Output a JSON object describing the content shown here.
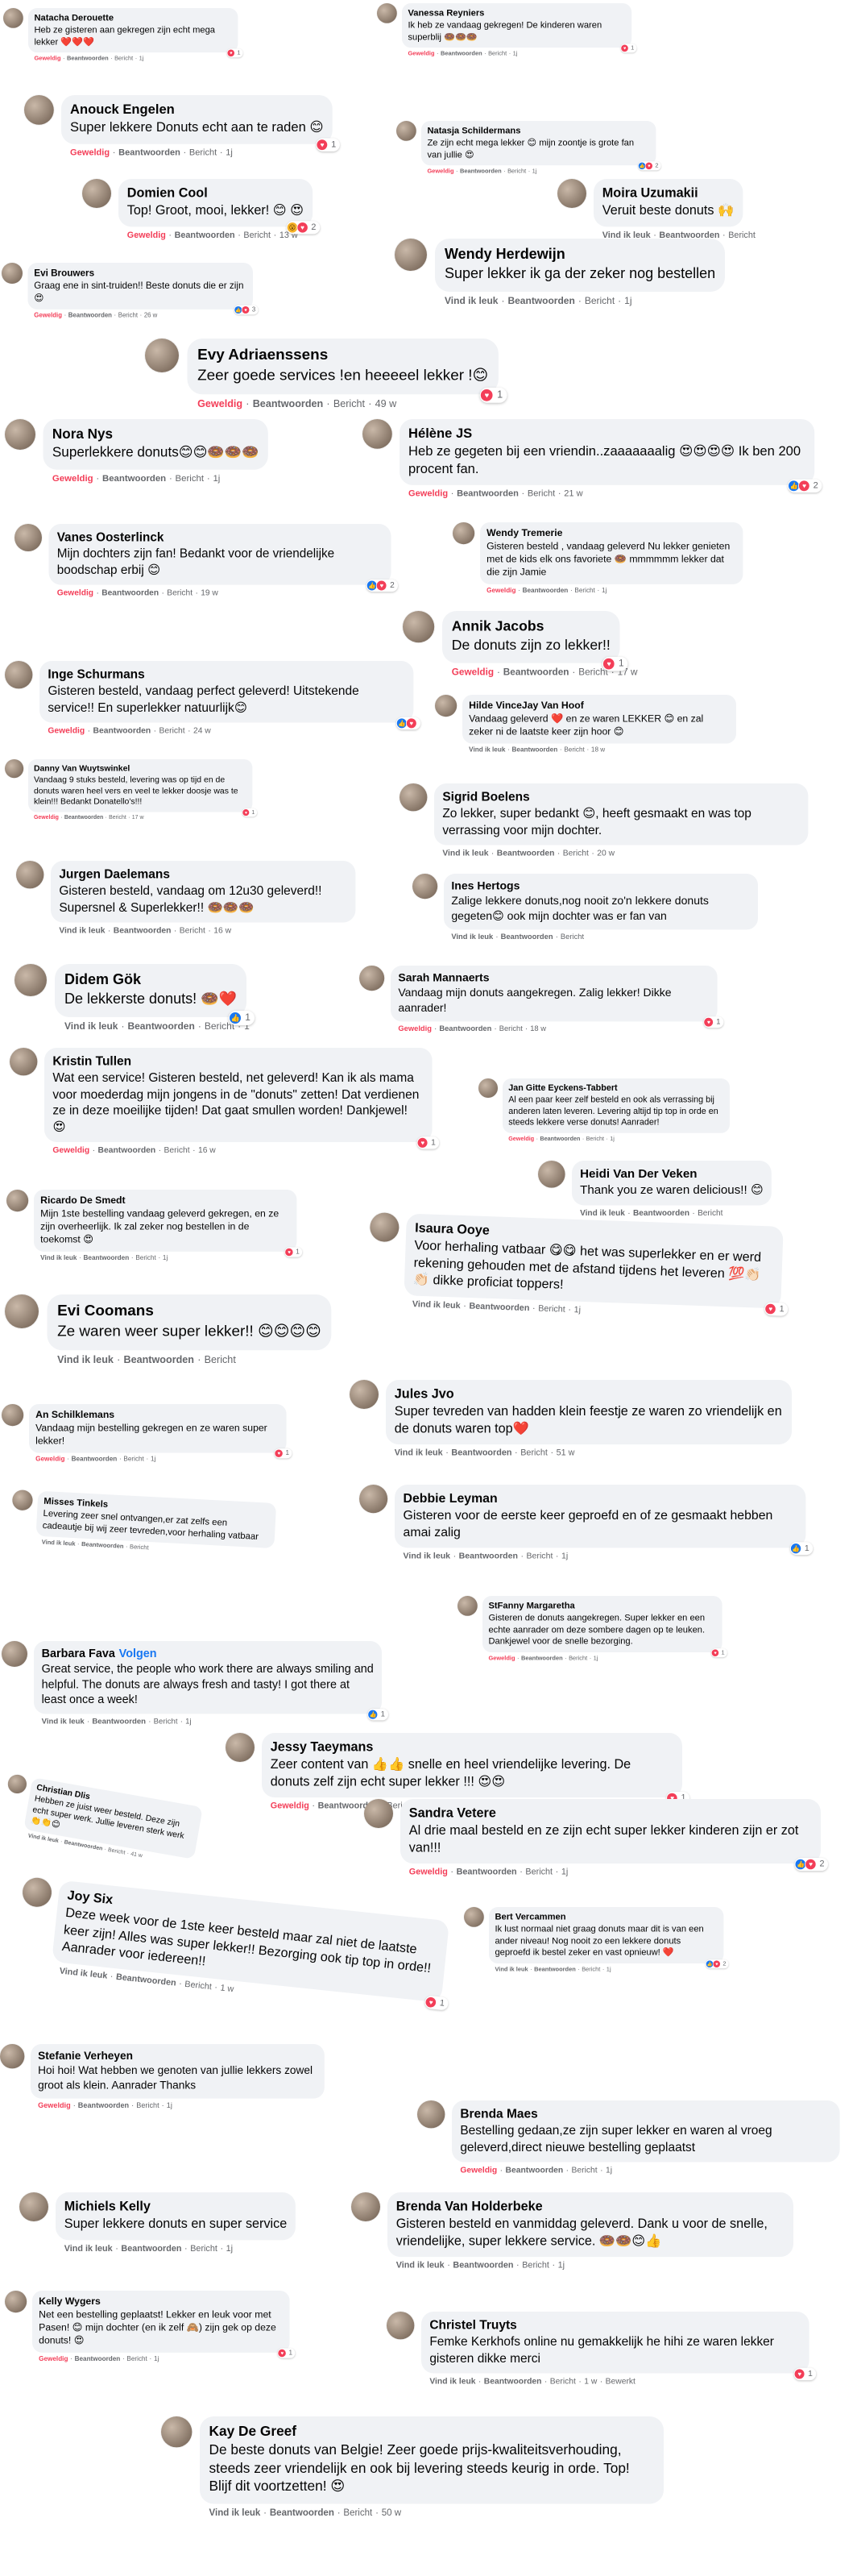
{
  "labels": {
    "like": "Vind ik leuk",
    "liked": "Geweldig",
    "reply": "Beantwoorden",
    "message": "Bericht",
    "edited": "Bewerkt",
    "follow": "Volgen"
  },
  "colors": {
    "bubble": "#f0f2f5",
    "liked": "#f33e58",
    "link": "#1877f2",
    "meta": "#65676b"
  },
  "comments": [
    {
      "name": "Natacha Derouette",
      "text": "Heb ze gisteren aan gekregen zijn echt mega lekker ❤️❤️❤️",
      "liked": true,
      "time": "1j",
      "reactions": [
        "heart"
      ],
      "count": "1"
    },
    {
      "name": "Vanessa Reyniers",
      "text": "Ik heb ze vandaag gekregen! De kinderen waren superblij 🍩🍩🍩",
      "liked": true,
      "time": "1j",
      "reactions": [
        "heart"
      ],
      "count": "1"
    },
    {
      "name": "Anouck Engelen",
      "text": "Super lekkere Donuts echt aan te raden 😊",
      "liked": true,
      "time": "1j",
      "reactions": [
        "heart"
      ],
      "count": "1"
    },
    {
      "name": "Natasja Schildermans",
      "text": "Ze zijn echt mega lekker 😊 mijn zoontje is grote fan van jullie 😍",
      "liked": true,
      "time": "1j",
      "reactions": [
        "like",
        "heart"
      ],
      "count": "2"
    },
    {
      "name": "Domien Cool",
      "text": "Top! Groot, mooi, lekker! 😊 😍",
      "liked": true,
      "time": "13 w",
      "reactions": [
        "wow",
        "heart"
      ],
      "count": "2"
    },
    {
      "name": "Moira Uzumakii",
      "text": "Veruit beste donuts 🙌",
      "liked": false,
      "time": "",
      "reactions": [],
      "count": ""
    },
    {
      "name": "Evi Brouwers",
      "text": "Graag ene in sint-truiden!! Beste donuts die er zijn 😍",
      "liked": true,
      "time": "26 w",
      "reactions": [
        "like",
        "heart"
      ],
      "count": "3"
    },
    {
      "name": "Wendy Herdewijn",
      "text": "Super lekker ik ga der zeker nog bestellen",
      "liked": false,
      "time": "1j",
      "reactions": [],
      "count": ""
    },
    {
      "name": "Evy Adriaenssens",
      "text": "Zeer goede services !en heeeeel lekker !😊",
      "liked": true,
      "time": "49 w",
      "reactions": [
        "heart"
      ],
      "count": "1"
    },
    {
      "name": "Nora Nys",
      "text": "Superlekkere donuts😊😊🍩🍩🍩",
      "liked": true,
      "time": "1j",
      "reactions": [],
      "count": ""
    },
    {
      "name": "Hélène JS",
      "text": "Heb ze gegeten bij een vriendin..zaaaaaaalig 😍😍😍😍 Ik ben 200 procent fan.",
      "liked": true,
      "time": "21 w",
      "reactions": [
        "like",
        "heart"
      ],
      "count": "2"
    },
    {
      "name": "Vanes Oosterlinck",
      "text": "Mijn dochters zijn fan! Bedankt voor de vriendelijke boodschap erbij 😊",
      "liked": true,
      "time": "19 w",
      "reactions": [
        "like",
        "heart"
      ],
      "count": "2"
    },
    {
      "name": "Wendy Tremerie",
      "text": "Gisteren besteld , vandaag geleverd Nu lekker genieten met de kids elk ons favoriete 🍩 mmmmmm lekker dat die zijn Jamie",
      "liked": true,
      "time": "1j",
      "reactions": [],
      "count": ""
    },
    {
      "name": "Annik Jacobs",
      "text": "De donuts zijn zo lekker!!",
      "liked": true,
      "time": "17 w",
      "reactions": [
        "heart"
      ],
      "count": "1"
    },
    {
      "name": "Inge Schurmans",
      "text": "Gisteren besteld, vandaag perfect geleverd! Uitstekende service!! En superlekker natuurlijk😊",
      "liked": true,
      "time": "24 w",
      "reactions": [
        "like",
        "heart"
      ],
      "count": ""
    },
    {
      "name": "Hilde VinceJay Van Hoof",
      "text": "Vandaag geleverd ❤️ en ze waren LEKKER 😊 en zal zeker ni de laatste keer zijn hoor 😊",
      "liked": false,
      "time": "18 w",
      "reactions": [],
      "count": ""
    },
    {
      "name": "Danny Van Wuytswinkel",
      "text": "Vandaag 9 stuks besteld, levering was op tijd en de donuts waren heel vers en veel te lekker doosje was te klein!!! Bedankt Donatello's!!!",
      "liked": true,
      "time": "17 w",
      "reactions": [
        "heart"
      ],
      "count": "1"
    },
    {
      "name": "Sigrid Boelens",
      "text": "Zo lekker, super bedankt 😊, heeft gesmaakt en was top verrassing voor mijn dochter.",
      "liked": false,
      "time": "20 w",
      "reactions": [],
      "count": ""
    },
    {
      "name": "Jurgen Daelemans",
      "text": "Gisteren besteld, vandaag om 12u30 geleverd!! Supersnel & Superlekker!! 🍩🍩🍩",
      "liked": false,
      "time": "16 w",
      "reactions": [],
      "count": ""
    },
    {
      "name": "Ines Hertogs",
      "text": "Zalige lekkere donuts,nog nooit zo'n lekkere donuts gegeten😊 ook mijn dochter was er fan van",
      "liked": false,
      "time": "",
      "reactions": [],
      "count": ""
    },
    {
      "name": "Didem Gök",
      "text": "De lekkerste donuts! 🍩❤️",
      "liked": false,
      "time": "1",
      "reactions": [
        "like"
      ],
      "count": "1"
    },
    {
      "name": "Sarah Mannaerts",
      "text": "Vandaag mijn donuts aangekregen. Zalig lekker! Dikke aanrader!",
      "liked": true,
      "time": "18 w",
      "reactions": [
        "heart"
      ],
      "count": "1"
    },
    {
      "name": "Kristin Tullen",
      "text": "Wat een service! Gisteren besteld, net geleverd! Kan ik als mama voor moederdag mijn jongens in de \"donuts\" zetten! Dat verdienen ze in deze moeilijke tijden! Dat gaat smullen worden! Dankjewel! 😍",
      "liked": true,
      "time": "16 w",
      "reactions": [
        "heart"
      ],
      "count": "1"
    },
    {
      "name": "Jan Gitte Eyckens-Tabbert",
      "text": "Al een paar keer zelf besteld en ook als verrassing bij anderen laten leveren. Levering altijd tip top in orde en steeds lekkere verse donuts! Aanrader!",
      "liked": true,
      "time": "1j",
      "reactions": [],
      "count": ""
    },
    {
      "name": "Heidi Van Der Veken",
      "text": "Thank you ze waren delicious!! 😊",
      "liked": false,
      "time": "",
      "reactions": [],
      "count": ""
    },
    {
      "name": "Ricardo De Smedt",
      "text": "Mijn 1ste bestelling vandaag geleverd gekregen, en ze zijn overheerlijk. Ik zal zeker nog bestellen in de toekomst 😍",
      "liked": false,
      "time": "1j",
      "reactions": [
        "heart"
      ],
      "count": "1"
    },
    {
      "name": "Isaura Ooye",
      "text": "Voor herhaling vatbaar 😋😋 het was superlekker en er werd rekening gehouden met de afstand tijdens het leveren 💯👏🏻👏🏻 dikke proficiat toppers!",
      "liked": false,
      "time": "1j",
      "reactions": [
        "heart"
      ],
      "count": "1"
    },
    {
      "name": "Evi Coomans",
      "text": "Ze waren weer super lekker!! 😊😊😊😊",
      "liked": false,
      "time": "",
      "reactions": [],
      "count": ""
    },
    {
      "name": "Jules Jvo",
      "text": "Super tevreden van hadden klein feestje ze waren zo vriendelijk en de donuts waren top❤️",
      "liked": false,
      "time": "51 w",
      "reactions": [],
      "count": ""
    },
    {
      "name": "An Schilklemans",
      "text": "Vandaag mijn bestelling gekregen en ze waren super lekker!",
      "liked": true,
      "time": "1j",
      "reactions": [
        "heart"
      ],
      "count": "1"
    },
    {
      "name": "Misses Tinkels",
      "text": "Levering zeer snel ontvangen,er zat zelfs een cadeautje bij wij zeer tevreden,voor herhaling vatbaar",
      "liked": false,
      "time": "",
      "reactions": [],
      "count": ""
    },
    {
      "name": "Debbie Leyman",
      "text": "Gisteren voor de eerste keer geproefd en of ze gesmaakt hebben amai zalig",
      "liked": false,
      "time": "1j",
      "reactions": [
        "like"
      ],
      "count": "1"
    },
    {
      "name": "StFanny Margaretha",
      "text": "Gisteren de donuts aangekregen. Super lekker en een echte aanrader om deze sombere dagen op te leuken. Dankjewel voor de snelle bezorging.",
      "liked": true,
      "time": "1j",
      "reactions": [
        "heart"
      ],
      "count": "1"
    },
    {
      "name": "Barbara Fava",
      "follow": true,
      "text": "Great service, the people who work there are always smiling and helpful. The donuts are always fresh and tasty! I got there at least once a week!",
      "liked": false,
      "time": "1j",
      "reactions": [
        "like"
      ],
      "count": "1"
    },
    {
      "name": "Jessy Taeymans",
      "text": "Zeer content van 👍👍 snelle en heel vriendelijke levering. De donuts zelf zijn echt super lekker !!! 😍😍",
      "liked": true,
      "time": "1j",
      "reactions": [
        "heart"
      ],
      "count": "1"
    },
    {
      "name": "Christian Dlis",
      "text": "Hebben ze juist weer besteld. Deze zijn echt super werk. Jullie leveren sterk werk 👏👏😊",
      "liked": false,
      "time": "41 w",
      "reactions": [],
      "count": ""
    },
    {
      "name": "Sandra Vetere",
      "text": "Al drie maal besteld en ze zijn echt super lekker kinderen zijn er zot van!!!",
      "liked": true,
      "time": "1j",
      "reactions": [
        "like",
        "heart"
      ],
      "count": "2"
    },
    {
      "name": "Joy Six",
      "text": "Deze week voor de 1ste keer besteld maar zal niet de laatste keer zijn! Alles was super lekker!! Bezorging ook tip top in orde!! Aanrader voor iedereen!!",
      "liked": false,
      "time": "1 w",
      "reactions": [
        "heart"
      ],
      "count": "1"
    },
    {
      "name": "Bert Vercammen",
      "text": "Ik lust normaal niet graag donuts maar dit is van een ander niveau! Nog nooit zo een lekkere donuts geproefd ik bestel zeker en vast opnieuw! ❤️",
      "liked": false,
      "time": "1j",
      "reactions": [
        "like",
        "heart"
      ],
      "count": "2"
    },
    {
      "name": "Stefanie Verheyen",
      "text": "Hoi hoi! Wat hebben we genoten van jullie lekkers zowel groot als klein. Aanrader Thanks",
      "liked": true,
      "time": "1j",
      "reactions": [],
      "count": ""
    },
    {
      "name": "Brenda Maes",
      "text": "Bestelling gedaan,ze zijn super lekker en waren al vroeg geleverd,direct nieuwe bestelling geplaatst",
      "liked": true,
      "time": "1j",
      "reactions": [],
      "count": ""
    },
    {
      "name": "Michiels Kelly",
      "text": "Super lekkere donuts en super service",
      "liked": false,
      "time": "1j",
      "reactions": [],
      "count": ""
    },
    {
      "name": "Brenda Van Holderbeke",
      "text": "Gisteren besteld en vanmiddag geleverd. Dank u voor de snelle, vriendelijke, super lekkere service. 🍩🍩😊👍",
      "liked": false,
      "time": "1j",
      "reactions": [],
      "count": ""
    },
    {
      "name": "Kelly Wygers",
      "text": "Net een bestelling geplaatst! Lekker en leuk voor met Pasen! 😊 mijn dochter (en ik zelf 🙈) zijn gek op deze donuts! 😍",
      "liked": true,
      "time": "1j",
      "reactions": [
        "heart"
      ],
      "count": "1"
    },
    {
      "name": "Christel Truyts",
      "text": "Femke Kerkhofs online nu gemakkelijk he hihi ze waren lekker gisteren dikke merci",
      "liked": false,
      "time": "1 w",
      "edited": true,
      "reactions": [
        "heart"
      ],
      "count": "1"
    },
    {
      "name": "Kay De Greef",
      "text": "De beste donuts van Belgie! Zeer goede prijs-kwaliteitsverhouding, steeds zeer vriendelijk en ook bij levering steeds keurig in orde. Top! Blijf dit voortzetten! 😍",
      "liked": false,
      "time": "50 w",
      "reactions": [],
      "count": ""
    }
  ]
}
